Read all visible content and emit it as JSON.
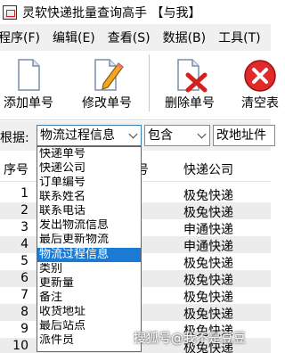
{
  "window": {
    "title": "灵软快递批量查询高手 【与我】"
  },
  "menubar": {
    "items": [
      "程序(F)",
      "编辑(E)",
      "查看(S)",
      "数据(B)",
      "工具(T)",
      "帮"
    ]
  },
  "toolbar": {
    "add_label": "添加单号",
    "edit_label": "修改单号",
    "delete_label": "删除单号",
    "clear_label": "清空表"
  },
  "filter": {
    "label": "根据:",
    "field_value": "物流过程信息",
    "condition_value": "包含",
    "text_value": "改地址件"
  },
  "grid": {
    "headers": {
      "index": "序号",
      "tracking": "号",
      "carrier": "快递公司"
    },
    "rows": [
      {
        "num": "1",
        "carrier": "极兔快递"
      },
      {
        "num": "2",
        "carrier": "极兔快递"
      },
      {
        "num": "3",
        "carrier": "申通快递"
      },
      {
        "num": "4",
        "carrier": "申通快递"
      },
      {
        "num": "5",
        "carrier": "极兔快递"
      },
      {
        "num": "6",
        "carrier": "极兔快递"
      },
      {
        "num": "7",
        "carrier": "极兔快递"
      },
      {
        "num": "8",
        "carrier": "极兔快递"
      },
      {
        "num": "9",
        "carrier": "极兔快递"
      },
      {
        "num": "10",
        "carrier": "极兔快递"
      },
      {
        "num": "11",
        "carrier": "极兔快递"
      }
    ]
  },
  "dropdown": {
    "options": [
      "快递单号",
      "快递公司",
      "订单编号",
      "联系姓名",
      "联系电话",
      "发出物流信息",
      "最后更新物流",
      "物流过程信息",
      "类别",
      "更新量",
      "备注",
      "收货地址",
      "最后站点",
      "派件员"
    ],
    "selected_index": 7
  },
  "watermark": {
    "text": "搜狐号@我不是豆豆"
  },
  "colors": {
    "selection": "#1a7ad4",
    "delete_x": "#d42020",
    "clear_icon": "#e02a2a"
  }
}
